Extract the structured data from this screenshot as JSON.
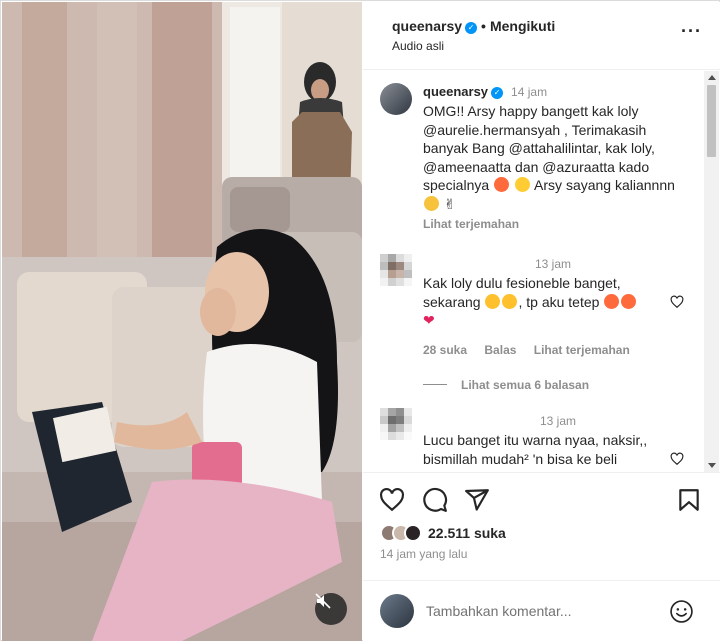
{
  "header": {
    "username": "queenarsy",
    "separator": "•",
    "follow_label": "Mengikuti",
    "audio": "Audio asli",
    "more_icon": "more-horizontal-icon"
  },
  "caption": {
    "username": "queenarsy",
    "time": "14 jam",
    "text_parts": {
      "t1": "OMG!! Arsy happy bangett kak loly @aurelie.hermansyah , Terimakasih banyak Bang @attahalilintar, kak loly, @ameenaatta dan @azuraatta kado specialnya",
      "t2": " Arsy sayang kaliannnn"
    },
    "see_translation": "Lihat terjemahan"
  },
  "comments": [
    {
      "time": "13 jam",
      "text_a": "Kak loly dulu fesioneble banget, sekarang",
      "text_b": ", tp aku tetep",
      "likes": "28 suka",
      "reply": "Balas",
      "see_translation": "Lihat terjemahan",
      "view_replies": "Lihat semua 6 balasan"
    },
    {
      "time": "13 jam",
      "text": "Lucu banget itu warna nyaa, naksir,, bismillah mudah² 'n bisa ke beli"
    }
  ],
  "actions": {
    "like_icon": "heart-icon",
    "comment_icon": "comment-icon",
    "share_icon": "share-icon",
    "save_icon": "bookmark-icon",
    "likes_count": "22.511 suka",
    "time_ago": "14 jam yang lalu"
  },
  "comment_input": {
    "placeholder": "Tambahkan komentar...",
    "emoji_icon": "emoji-icon"
  },
  "colors": {
    "accent": "#0095f6",
    "text": "#262626",
    "muted": "#8e8e8e",
    "heart": "#ed4956"
  }
}
